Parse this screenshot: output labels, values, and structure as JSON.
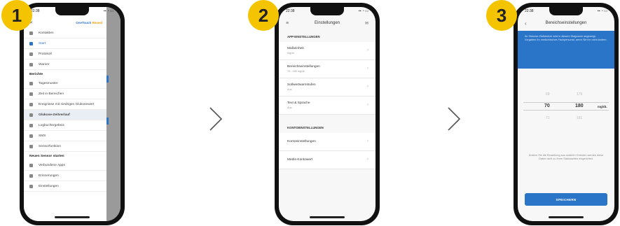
{
  "steps": [
    "1",
    "2",
    "3"
  ],
  "phone1": {
    "time": "22:38",
    "logo": "OneTouch",
    "logo_accent": "Reveal",
    "nav": [
      {
        "label": "Kontakten",
        "active": false,
        "type": "item"
      },
      {
        "label": "Start",
        "active": true,
        "type": "item"
      },
      {
        "label": "Protokoll",
        "active": false,
        "type": "item"
      },
      {
        "label": "Warner",
        "active": false,
        "type": "item"
      },
      {
        "label": "Berichte",
        "active": false,
        "type": "section"
      },
      {
        "label": "Tagesmuster",
        "active": false,
        "type": "item"
      },
      {
        "label": "Zeit in Bereichen",
        "active": false,
        "type": "item"
      },
      {
        "label": "Ereignisse mit niedrigen Glukosewert",
        "active": false,
        "type": "item"
      },
      {
        "label": "Glukose-Zeitverlauf",
        "active": false,
        "type": "highlight"
      },
      {
        "label": "Logbuchergebnis",
        "active": false,
        "type": "item"
      },
      {
        "label": "SMS",
        "active": false,
        "type": "item"
      },
      {
        "label": "Sensorfunktion",
        "active": false,
        "type": "item"
      },
      {
        "label": "Neuen Sensor starten",
        "active": false,
        "type": "section"
      },
      {
        "label": "Verbundene Apps",
        "active": false,
        "type": "item"
      },
      {
        "label": "Erinnerungen",
        "active": false,
        "type": "item"
      },
      {
        "label": "Einstellungen",
        "active": false,
        "type": "item"
      }
    ]
  },
  "phone2": {
    "time": "22:38",
    "title": "Einstellungen",
    "section_app": "APP-EINSTELLUNGEN",
    "app_rows": [
      {
        "title": "Maßeinheit",
        "value": "mg/dL"
      },
      {
        "title": "Bereichseinstellungen",
        "value": "70 - 180 mg/dL"
      },
      {
        "title": "Sollwertwarnstufen",
        "value": "Aus"
      },
      {
        "title": "Text & Sprache",
        "value": "Aus"
      }
    ],
    "section_account": "KONTOEINSTELLUNGEN",
    "account_rows": [
      {
        "title": "Kontoeinstellungen",
        "value": ""
      },
      {
        "title": "Medis-Kontowert",
        "value": ""
      }
    ]
  },
  "phone3": {
    "time": "22:38",
    "title": "Bereichseinstellungen",
    "banner": "Ihr Glukose-Zielbereich wird in diesem Diagramm angezeigt. Vorgaben Ihr medizinisches Fachpersonal, wenn Sie ihn nicht ändern.",
    "picker_low": [
      "69",
      "70",
      "71"
    ],
    "picker_high": [
      "179",
      "180",
      "181"
    ],
    "unit": "mg/dL",
    "note": "Ändern Sie die Einstellung aus anderen Gründen werden diese Daten nicht zu Ihren Statusseiten eingerichtet.",
    "save_label": "SPEICHERN"
  }
}
